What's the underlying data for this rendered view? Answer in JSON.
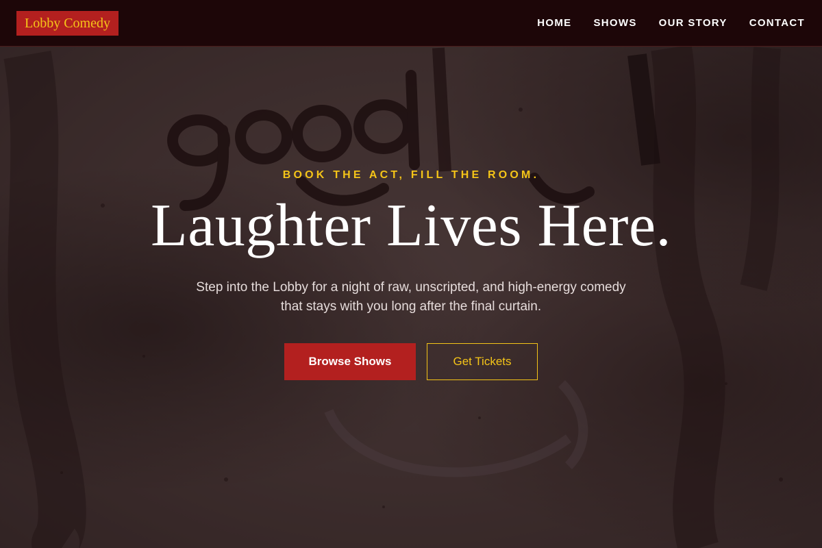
{
  "header": {
    "logo_text": "Lobby Comedy",
    "nav": [
      {
        "label": "HOME"
      },
      {
        "label": "SHOWS"
      },
      {
        "label": "OUR STORY"
      },
      {
        "label": "CONTACT"
      }
    ]
  },
  "hero": {
    "eyebrow": "BOOK THE ACT, FILL THE ROOM.",
    "headline": "Laughter Lives Here.",
    "subtitle": "Step into the Lobby for a night of raw, unscripted, and high-energy comedy that stays with you long after the final curtain.",
    "primary_button": "Browse Shows",
    "secondary_button": "Get Tickets"
  },
  "colors": {
    "header_bg": "#1d0608",
    "brand_red": "#b3201f",
    "accent_yellow": "#f5c518",
    "text_white": "#ffffff"
  },
  "background": {
    "graffiti_text": "good"
  }
}
